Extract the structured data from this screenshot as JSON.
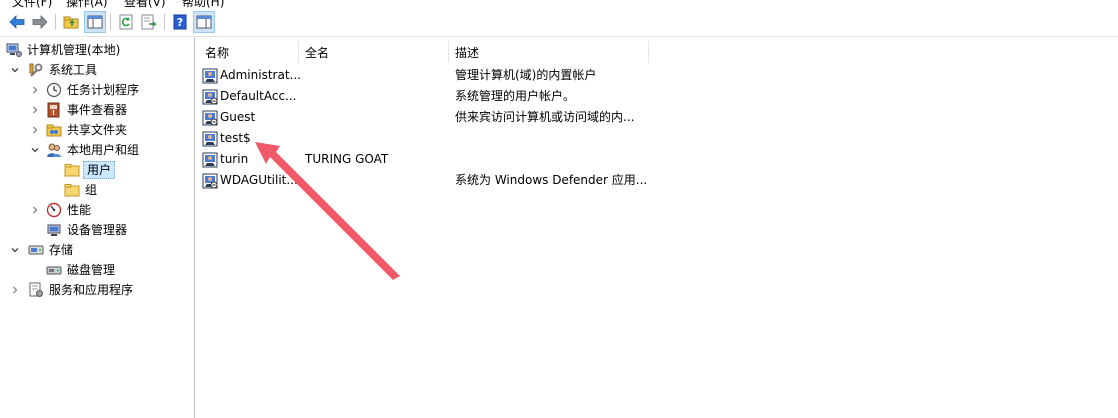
{
  "menubar": {
    "items": [
      "文件(F)",
      "操作(A)",
      "查看(V)",
      "帮助(H)"
    ]
  },
  "toolbar": {
    "buttons": [
      {
        "name": "back-icon"
      },
      {
        "name": "forward-icon"
      },
      {
        "name": "up-folder-icon"
      },
      {
        "name": "show-hide-console-tree-icon"
      },
      {
        "name": "refresh-icon"
      },
      {
        "name": "export-list-icon"
      },
      {
        "name": "help-icon"
      },
      {
        "name": "show-hide-action-pane-icon"
      }
    ]
  },
  "tree": {
    "root": "计算机管理(本地)",
    "system_tools": "系统工具",
    "task_scheduler": "任务计划程序",
    "event_viewer": "事件查看器",
    "shared_folders": "共享文件夹",
    "local_users_groups": "本地用户和组",
    "users": "用户",
    "groups": "组",
    "performance": "性能",
    "device_manager": "设备管理器",
    "storage": "存储",
    "disk_management": "磁盘管理",
    "services_apps": "服务和应用程序"
  },
  "list": {
    "columns": [
      "名称",
      "全名",
      "描述"
    ],
    "rows": [
      {
        "name": "Administrat...",
        "full_name": "",
        "description": "管理计算机(域)的内置帐户"
      },
      {
        "name": "DefaultAcc...",
        "full_name": "",
        "description": "系统管理的用户帐户。"
      },
      {
        "name": "Guest",
        "full_name": "",
        "description": "供来宾访问计算机或访问域的内..."
      },
      {
        "name": "test$",
        "full_name": "",
        "description": ""
      },
      {
        "name": "turin",
        "full_name": "TURING GOAT",
        "description": ""
      },
      {
        "name": "WDAGUtilit...",
        "full_name": "",
        "description": "系统为 Windows Defender 应用..."
      }
    ]
  },
  "annotation": {
    "color": "#f05a68"
  }
}
